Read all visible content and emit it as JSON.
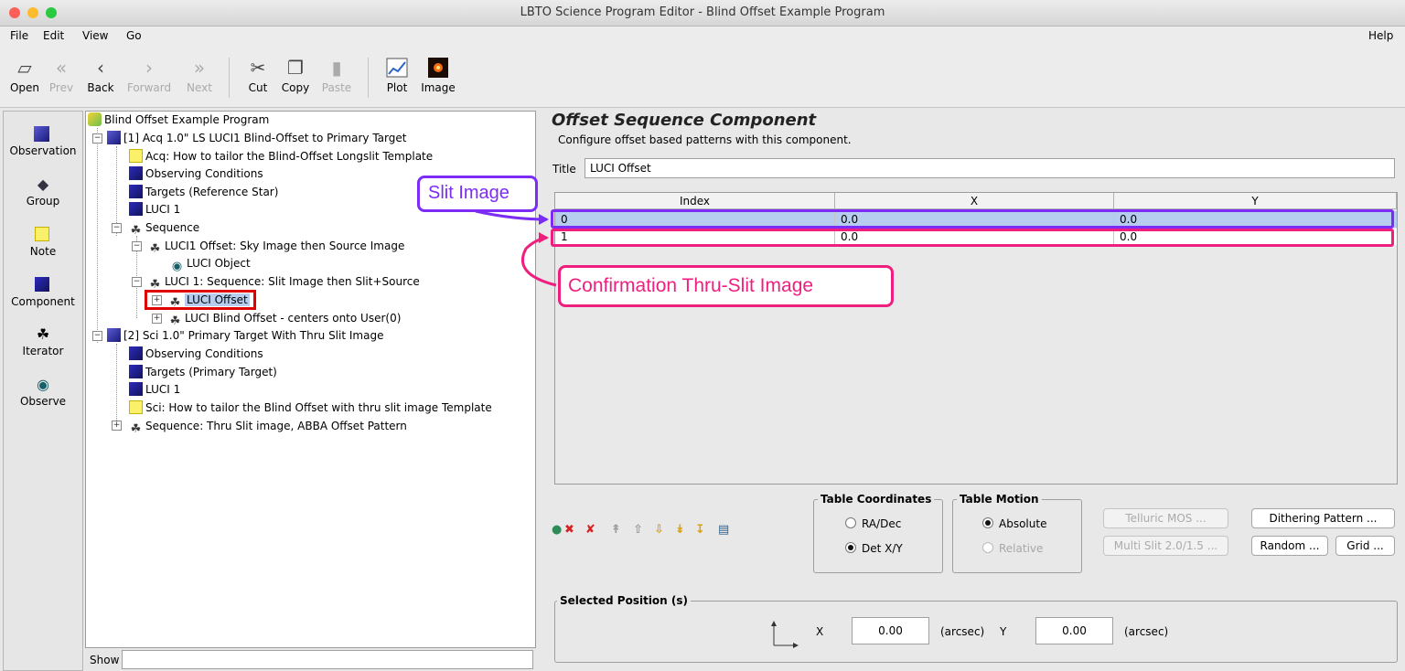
{
  "window": {
    "title": "LBTO Science Program Editor - Blind Offset Example Program"
  },
  "menu": {
    "file": "File",
    "edit": "Edit",
    "view": "View",
    "go": "Go",
    "help": "Help"
  },
  "toolbar": {
    "open": "Open",
    "prev": "Prev",
    "back": "Back",
    "forward": "Forward",
    "next": "Next",
    "cut": "Cut",
    "copy": "Copy",
    "paste": "Paste",
    "plot": "Plot",
    "image": "Image"
  },
  "palette": {
    "observation": "Observation",
    "group": "Group",
    "note": "Note",
    "component": "Component",
    "iterator": "Iterator",
    "observe": "Observe"
  },
  "tree": {
    "program": "Blind Offset Example Program",
    "obs1": "[1] Acq 1.0\" LS LUCI1 Blind-Offset to Primary Target",
    "obs1_note": "Acq: How to tailor the Blind-Offset Longslit Template",
    "obs1_cond": "Observing Conditions",
    "obs1_targets": "Targets (Reference Star)",
    "obs1_luci": "LUCI 1",
    "obs1_seq": "Sequence",
    "seq_a": "LUCI1 Offset: Sky Image then Source Image",
    "seq_a_obj": "LUCI Object",
    "seq_b": "LUCI 1: Sequence: Slit Image then Slit+Source",
    "seq_b_offset": "LUCI Offset",
    "seq_b_blind": "LUCI Blind Offset - centers onto User(0)",
    "obs2": "[2] Sci 1.0\" Primary Target With Thru Slit Image",
    "obs2_cond": "Observing Conditions",
    "obs2_targets": "Targets (Primary Target)",
    "obs2_luci": "LUCI 1",
    "obs2_note": "Sci: How to tailor the Blind Offset with thru slit image Template",
    "obs2_seq": "Sequence: Thru Slit image, ABBA Offset Pattern",
    "show": "Show"
  },
  "component": {
    "heading": "Offset Sequence Component",
    "description": "Configure offset based patterns with this component.",
    "title_label": "Title",
    "title_value": "LUCI Offset"
  },
  "table": {
    "headers": [
      "Index",
      "X",
      "Y"
    ],
    "rows": [
      [
        "0",
        "0.0",
        "0.0"
      ],
      [
        "1",
        "0.0",
        "0.0"
      ]
    ]
  },
  "annotations": {
    "slit_image": "Slit Image",
    "confirmation": "Confirmation Thru-Slit Image",
    "purple": "#7b2cf5",
    "pink": "#ee1f7f"
  },
  "coords": {
    "title": "Table Coordinates",
    "ra_dec": "RA/Dec",
    "det_xy": "Det X/Y",
    "selected": "Det X/Y"
  },
  "motion": {
    "title": "Table Motion",
    "absolute": "Absolute",
    "relative": "Relative",
    "selected": "Absolute"
  },
  "buttons": {
    "telluric": "Telluric MOS ...",
    "multislit": "Multi Slit 2.0/1.5 ...",
    "dithering": "Dithering Pattern ...",
    "random": "Random ...",
    "grid": "Grid ..."
  },
  "selected_position": {
    "title": "Selected Position (s)",
    "x_label": "X",
    "x_value": "0.00",
    "x_unit": "(arcsec)",
    "y_label": "Y",
    "y_value": "0.00",
    "y_unit": "(arcsec)"
  },
  "colors": {
    "selection": "#b7cdf0",
    "highlight_red": "#e00000"
  }
}
